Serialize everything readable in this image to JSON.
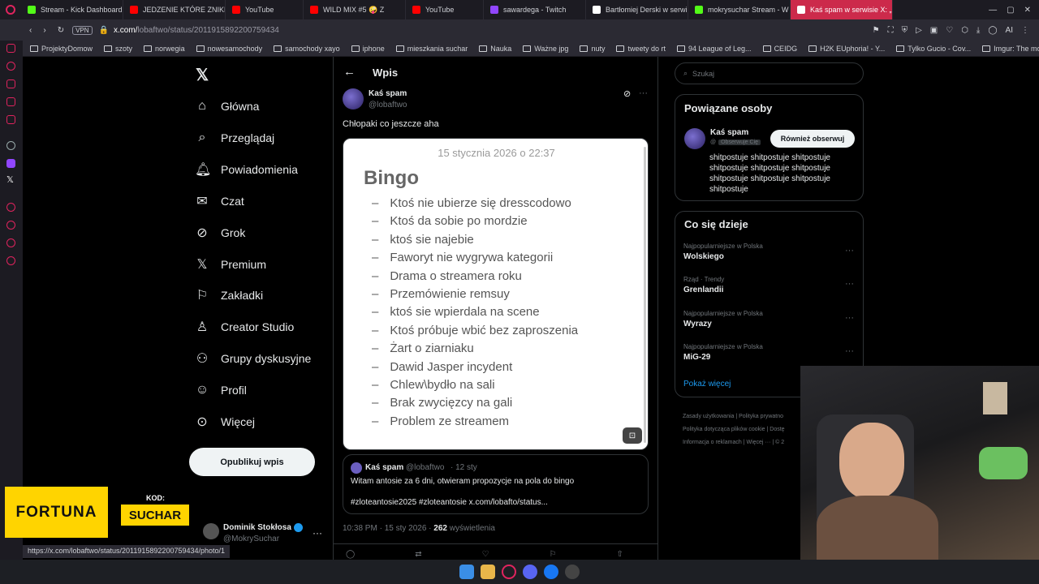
{
  "browser": {
    "tabs": [
      {
        "label": "Stream - Kick Dashboard",
        "color": "#53fc18"
      },
      {
        "label": "JEDZENIE KTÓRE ZNIKNĘ",
        "color": "#ff0000"
      },
      {
        "label": "YouTube",
        "color": "#ff0000"
      },
      {
        "label": "WILD MIX #5 🤪 Z",
        "color": "#ff0000"
      },
      {
        "label": "YouTube",
        "color": "#ff0000"
      },
      {
        "label": "sawardega - Twitch",
        "color": "#9146ff"
      },
      {
        "label": "Bartłomiej Derski w serwi",
        "color": "#ffffff"
      },
      {
        "label": "mokrysuchar Stream - W",
        "color": "#53fc18"
      },
      {
        "label": "Kaś spam w serwisie X: „C",
        "color": "#ffffff"
      }
    ],
    "url_prefix": "x.com/",
    "url_path": "lobaftwo/status/2011915892200759434",
    "vpn_label": "VPN",
    "ai_label": "AI",
    "bookmarks": [
      "ProjektyDomow",
      "szoty",
      "norwegia",
      "nowesamochody",
      "samochody xayo",
      "iphone",
      "mieszkania suchar",
      "Nauka",
      "Ważne jpg",
      "nuty",
      "tweety do rt",
      "94 League of Leg...",
      "CEIDG",
      "H2K EUphoria! - Y...",
      "Tylko Gucio - Cov...",
      "Imgur: The most a..."
    ],
    "status_url": "https://x.com/lobaftwo/status/2011915892200759434/photo/1"
  },
  "nav": {
    "items": [
      {
        "label": "Główna",
        "icon": "home-icon"
      },
      {
        "label": "Przeglądaj",
        "icon": "search-icon"
      },
      {
        "label": "Powiadomienia",
        "icon": "bell-icon"
      },
      {
        "label": "Czat",
        "icon": "mail-icon"
      },
      {
        "label": "Grok",
        "icon": "grok-icon"
      },
      {
        "label": "Premium",
        "icon": "x-logo-icon"
      },
      {
        "label": "Zakładki",
        "icon": "bookmark-icon"
      },
      {
        "label": "Creator Studio",
        "icon": "creator-icon"
      },
      {
        "label": "Grupy dyskusyjne",
        "icon": "groups-icon"
      },
      {
        "label": "Profil",
        "icon": "profile-icon"
      },
      {
        "label": "Więcej",
        "icon": "more-icon"
      }
    ],
    "post_button": "Opublikuj wpis",
    "account_name": "Dominik Stokłosa",
    "account_handle": "@MokrySuchar"
  },
  "post": {
    "header_title": "Wpis",
    "author_name": "Kaś spam",
    "author_handle": "@lobaftwo",
    "text": "Chłopaki co jeszcze aha",
    "image": {
      "date": "15 stycznia 2026 o 22:37",
      "title": "Bingo",
      "items": [
        "Ktoś nie ubierze się dresscodowo",
        "Ktoś da sobie po mordzie",
        "ktoś sie najebie",
        "Faworyt nie wygrywa kategorii",
        "Drama o streamera roku",
        "Przemówienie remsuy",
        "ktoś sie wpierdala na scene",
        "Ktoś próbuje wbić bez zaproszenia",
        "Żart o ziarniaku",
        "Dawid Jasper incydent",
        "Chlew\\bydło na sali",
        "Brak zwycięzcy na gali",
        "Problem ze streamem"
      ]
    },
    "quote": {
      "author_name": "Kaś spam",
      "author_handle": "@lobaftwo",
      "time": "· 12 sty",
      "text": "Witam antosie za 6 dni, otwieram propozycje na pola do bingo",
      "tags": "#zloteantosie2025 #zloteantosie x.com/lobafto/status..."
    },
    "meta_time": "10:38 PM · 15 sty 2026 ·",
    "views_count": "262",
    "views_label": "wyświetlenia"
  },
  "sidebar": {
    "search_placeholder": "Szukaj",
    "related_title": "Powiązane osoby",
    "related_name": "Kaś spam",
    "related_badge": "Obserwuje Cię",
    "follow_back_label": "Również obserwuj",
    "related_bio": "shitpostuje shitpostuje shitpostuje shitpostuje shitpostuje shitpostuje shitpostuje shitpostuje shitpostuje shitpostuje",
    "trending_title": "Co się dzieje",
    "trends": [
      {
        "meta": "Najpopularniejsze w Polska",
        "name": "Wolskiego"
      },
      {
        "meta": "Rząd · Trendy",
        "name": "Grenlandii"
      },
      {
        "meta": "Najpopularniejsze w Polska",
        "name": "Wyrazy"
      },
      {
        "meta": "Najpopularniejsze w Polska",
        "name": "MiG-29"
      }
    ],
    "show_more": "Pokaż więcej",
    "footer": [
      "Zasady użytkowania",
      "Polityka prywatno",
      "Polityka dotycząca plików cookie",
      "Dostę",
      "Informacja o reklamach",
      "Więcej ···",
      "© 2"
    ]
  },
  "overlay": {
    "brand": "FORTUNA",
    "code_label": "KOD:",
    "code": "SUCHAR"
  }
}
